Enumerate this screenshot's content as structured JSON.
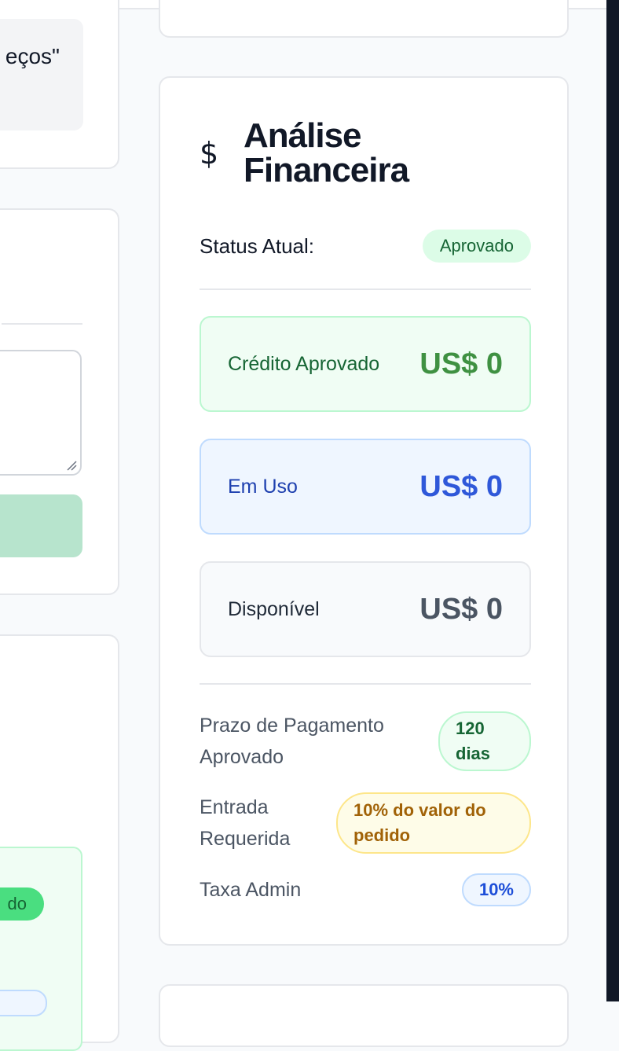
{
  "left_column": {
    "quote_fragment": "eços\""
  },
  "financial_card": {
    "icon": "dollar-icon",
    "icon_glyph": "$",
    "title": "Análise Financeira",
    "status_label": "Status Atual:",
    "status_value": "Aprovado",
    "metrics": [
      {
        "label": "Crédito Aprovado",
        "value": "US$ 0"
      },
      {
        "label": "Em Uso",
        "value": "US$ 0"
      },
      {
        "label": "Disponível",
        "value": "US$ 0"
      }
    ],
    "terms": [
      {
        "label": "Prazo de Pagamento Aprovado",
        "value": "120 dias"
      },
      {
        "label": "Entrada Requerida",
        "value": "10% do valor do pedido"
      },
      {
        "label": "Taxa Admin",
        "value": "10%"
      }
    ]
  },
  "colors": {
    "green_text": "#166534",
    "green_value": "#3f9142",
    "blue_value": "#2f58d9",
    "gray_value": "#4b5563",
    "yellow_text": "#a16207"
  }
}
